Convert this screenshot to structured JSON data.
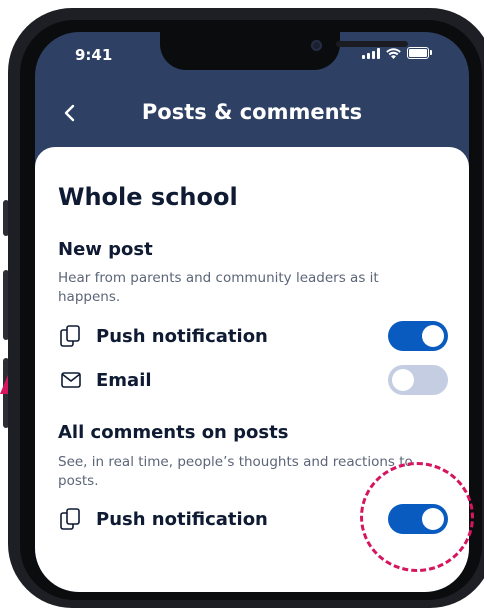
{
  "status_bar": {
    "time": "9:41"
  },
  "header": {
    "title": "Posts & comments"
  },
  "section": {
    "title": "Whole school"
  },
  "groups": [
    {
      "title": "New post",
      "description": "Hear from parents and community leaders as it happens.",
      "rows": [
        {
          "label": "Push notification",
          "icon": "push-notification-icon",
          "enabled": true
        },
        {
          "label": "Email",
          "icon": "mail-icon",
          "enabled": false
        }
      ]
    },
    {
      "title": "All comments on posts",
      "description": "See, in real time, people’s thoughts and reactions to posts.",
      "rows": [
        {
          "label": "Push notification",
          "icon": "push-notification-icon",
          "enabled": true
        }
      ]
    }
  ],
  "colors": {
    "header_bg": "#2e4064",
    "toggle_on": "#0a5bbf",
    "toggle_off": "#c4cde1",
    "highlight": "#d6155f",
    "text_primary": "#0f1a33",
    "text_secondary": "#5c6578"
  }
}
